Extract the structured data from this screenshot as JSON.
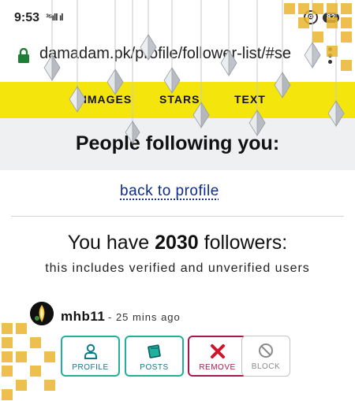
{
  "status_bar": {
    "time": "9:53",
    "signal": "³⁵ıll ıl",
    "alarm": "⊙",
    "battery": "82"
  },
  "browser": {
    "url": "damadam.pk/profile/follower-list/#se",
    "menu_icon": "kebab-menu-icon"
  },
  "nav": {
    "images": "IMAGES",
    "stars": "STARS",
    "text": "TEXT"
  },
  "page": {
    "title": "People following you:",
    "back_link": "back to profile",
    "followers_prefix": "You have ",
    "followers_count": "2030",
    "followers_suffix": " followers:",
    "subtitle": "this includes verified and unverified users"
  },
  "follower": {
    "username": "mhb11",
    "meta": "- 25 mins ago",
    "actions": {
      "profile": "PROFILE",
      "posts": "POSTS",
      "remove": "REMOVE",
      "block": "BLOCK"
    }
  },
  "colors": {
    "nav_yellow": "#f4e60c",
    "link_blue": "#0c2c8e",
    "teal": "#1fb19a",
    "remove_red": "#a8174f",
    "heading_band": "#eef0f2",
    "deco_gold": "#e9b530"
  }
}
